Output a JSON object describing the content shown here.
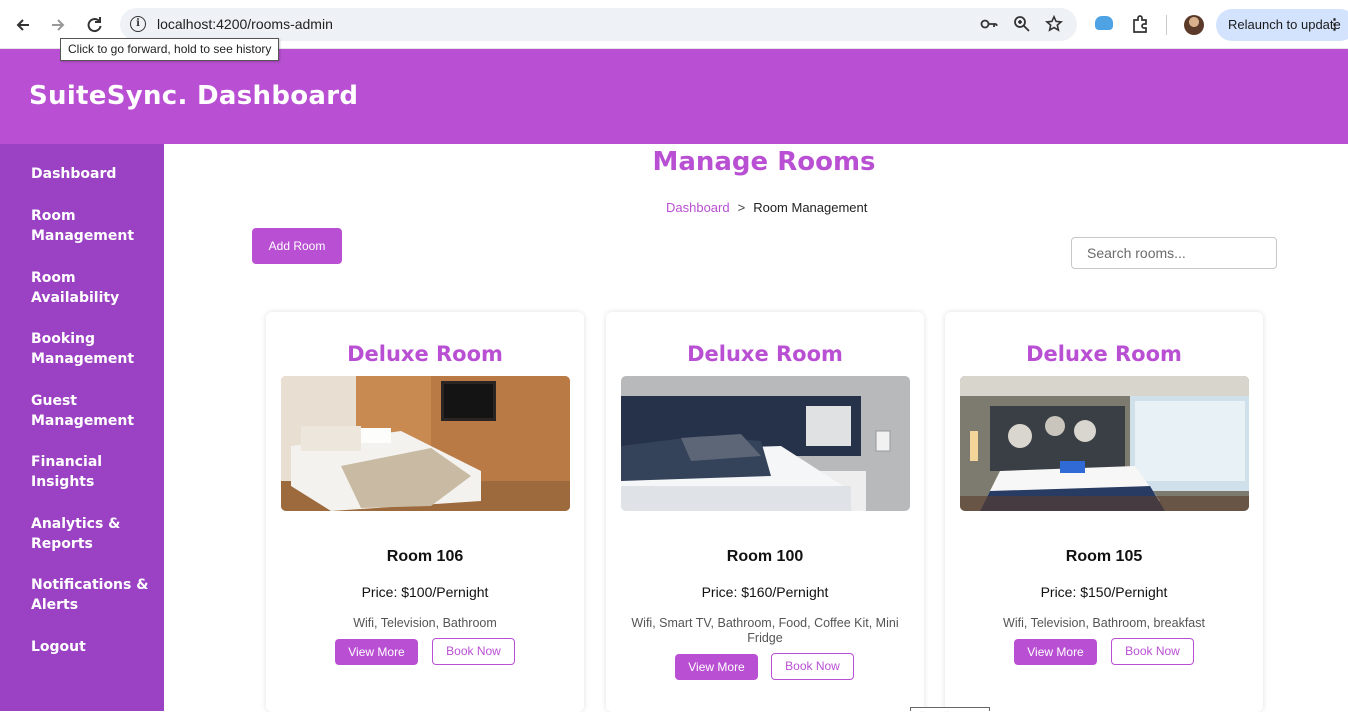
{
  "browser": {
    "url": "localhost:4200/rooms-admin",
    "tooltip": "Click to go forward, hold to see history",
    "relaunch_label": "Relaunch to update",
    "icons": [
      "back-icon",
      "forward-icon",
      "reload-icon",
      "site-info-icon",
      "key-icon",
      "zoom-icon",
      "star-icon",
      "cloud-icon",
      "extensions-icon",
      "profile-avatar",
      "menu-dots-icon"
    ]
  },
  "header": {
    "title": "SuiteSync. Dashboard"
  },
  "sidebar": {
    "items": [
      {
        "label": "Dashboard"
      },
      {
        "label": "Room Management"
      },
      {
        "label": "Room Availability"
      },
      {
        "label": "Booking Management"
      },
      {
        "label": "Guest Management"
      },
      {
        "label": "Financial Insights"
      },
      {
        "label": "Analytics & Reports"
      },
      {
        "label": "Notifications & Alerts"
      },
      {
        "label": "Logout"
      }
    ]
  },
  "main": {
    "heading": "Manage Rooms",
    "breadcrumb": {
      "link": "Dashboard",
      "separator": ">",
      "current": "Room Management"
    },
    "add_button": "Add Room",
    "search_placeholder": "Search rooms...",
    "cards": [
      {
        "type": "Deluxe Room",
        "name": "Room 106",
        "price": "Price: $100/Pernight",
        "amenities": "Wifi, Television, Bathroom",
        "more_label": "View More",
        "book_label": "Book Now"
      },
      {
        "type": "Deluxe Room",
        "name": "Room 100",
        "price": "Price: $160/Pernight",
        "amenities": "Wifi, Smart TV, Bathroom, Food, Coffee Kit, Mini Fridge",
        "more_label": "View More",
        "book_label": "Book Now"
      },
      {
        "type": "Deluxe Room",
        "name": "Room 105",
        "price": "Price: $150/Pernight",
        "amenities": "Wifi, Television, Bathroom, breakfast",
        "more_label": "View More",
        "book_label": "Book Now"
      }
    ]
  },
  "colors": {
    "accent": "#b950d3",
    "sidebar": "#9b41c3"
  }
}
